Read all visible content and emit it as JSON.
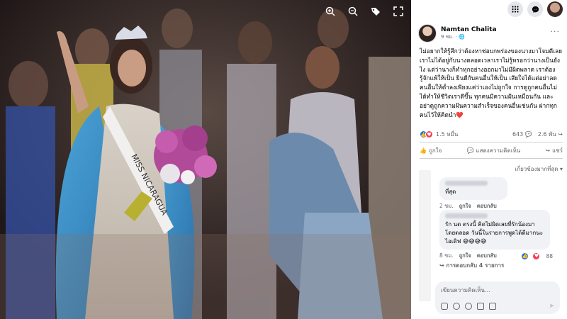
{
  "viewer": {
    "icons": [
      "zoom-in-icon",
      "zoom-out-icon",
      "tag-icon",
      "fullscreen-icon"
    ],
    "sash_text": "MISS NICARAGUA"
  },
  "topbar": {
    "icons": [
      "apps-grid-icon",
      "messenger-icon",
      "profile-avatar"
    ]
  },
  "post": {
    "author": "Namtan Chalita",
    "meta": "9 ชม. · 🌐",
    "more": "···",
    "text": "ไม่อยากให้รู้สึกว่าต้องหาช่อบกพร่องของนางมาโจมตีเลย เราไม่ได้อยู่กับนางตลอดเวลาเราไม่รู้หรอกว่านางเป็นยังไง แต่ว่านางก็ทำทุกอย่างออกมาไม่มีผิดพลาด เราต้องรู้จักแพ้ให้เป็น ยินดีกับคนอื่นให้เป็น เสียใจได้แต่อย่าลดคนอื่นให้ต่ำลงเพียงแค่ว่าเองไม่ถูกใจ การดูถูกคนอื่นไม่ได้ทำให้ชีวิตเราดีขึ้น ทุกคนมีความฝันเหมือนกัน และอย่าดูถูกความฝันความสำเร็จของคนอื่นเช่นกัน ฝากทุกคนไว้ให้คิดนำ❤️"
  },
  "reactions": {
    "count": "1.5 หมื่น",
    "comments": "643 💬",
    "shares": "2.6 พัน ↪"
  },
  "actions": {
    "like": "ถูกใจ",
    "comment": "แสดงความคิดเห็น",
    "share": "แชร์"
  },
  "sort_label": "เกี่ยวข้องมากที่สุด ▾",
  "comments": [
    {
      "text": "ที่สุด",
      "time": "2 ชม.",
      "like": "ถูกใจ",
      "reply": "ตอบกลับ"
    },
    {
      "text": "รัก นต ตรงนี้ คิดไม่ผิดเลยที่รักน้องมาโดยตลอด วันนี้ในรายการพูดได้ดีมากนะไอเดิฟ 😅😅😅😅",
      "time": "8 ชม.",
      "like": "ถูกใจ",
      "reply": "ตอบกลับ",
      "reaction_count": "88"
    }
  ],
  "view_replies": "↪ การตอบกลับ 4 รายการ",
  "write": {
    "placeholder": "เขียนความคิดเห็น...",
    "send": "➤"
  }
}
